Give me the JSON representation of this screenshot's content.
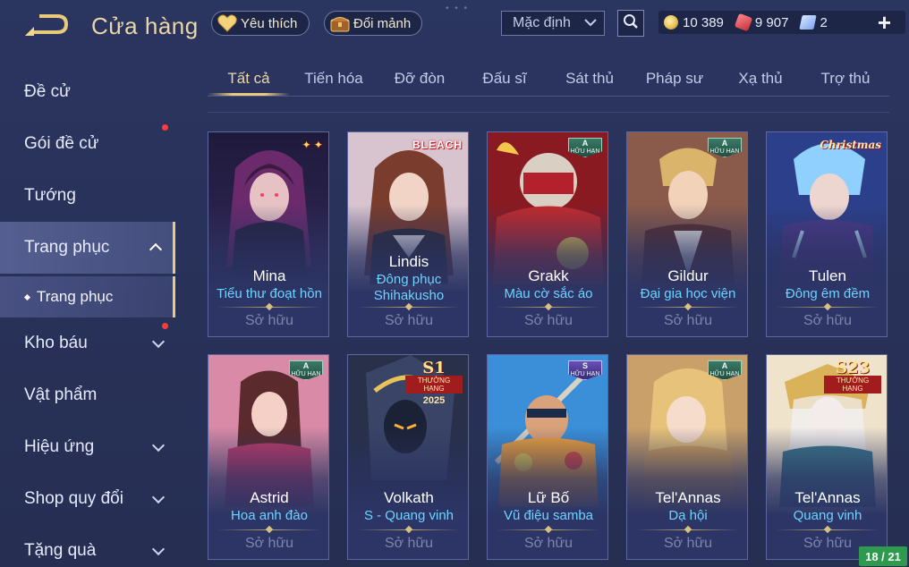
{
  "header": {
    "title": "Cửa hàng",
    "favorites_label": "Yêu thích",
    "shards_label": "Đổi mảnh",
    "sort_selected": "Mặc định",
    "currencies": [
      {
        "name": "gold",
        "icon": "gold-coin-icon",
        "value": "10 389",
        "color": "#e8c15a"
      },
      {
        "name": "gems",
        "icon": "red-gem-icon",
        "value": "9 907",
        "color": "#e0525a"
      },
      {
        "name": "vouchers",
        "icon": "voucher-icon",
        "value": "2",
        "color": "#8fb6ff"
      }
    ]
  },
  "sidebar": {
    "items": [
      {
        "label": "Đề cử"
      },
      {
        "label": "Gói đề cử"
      },
      {
        "label": "Tướng"
      },
      {
        "label": "Trang phục"
      },
      {
        "label": "Kho báu"
      },
      {
        "label": "Vật phẩm"
      },
      {
        "label": "Hiệu ứng"
      },
      {
        "label": "Shop quy đổi"
      },
      {
        "label": "Tặng quà"
      }
    ],
    "sub_item": "Trang phục"
  },
  "tabs": [
    {
      "label": "Tất cả"
    },
    {
      "label": "Tiến hóa"
    },
    {
      "label": "Đỡ đòn"
    },
    {
      "label": "Đấu sĩ"
    },
    {
      "label": "Sát thủ"
    },
    {
      "label": "Pháp sư"
    },
    {
      "label": "Xạ thủ"
    },
    {
      "label": "Trợ thủ"
    }
  ],
  "cards": [
    {
      "hero": "Mina",
      "skin": "Tiểu thư đoạt hồn",
      "status": "Sở hữu"
    },
    {
      "hero": "Lindis",
      "skin": "Đông phục Shihakusho",
      "status": "Sở hữu",
      "badge_text": "BLEACH"
    },
    {
      "hero": "Grakk",
      "skin": "Màu cờ sắc áo",
      "status": "Sở hữu",
      "badge": "A",
      "badge_sub": "HỮU HẠN"
    },
    {
      "hero": "Gildur",
      "skin": "Đại gia học viện",
      "status": "Sở hữu",
      "badge": "A",
      "badge_sub": "HỮU HẠN"
    },
    {
      "hero": "Tulen",
      "skin": "Đông êm đềm",
      "status": "Sở hữu",
      "badge_text": "Christmas"
    },
    {
      "hero": "Astrid",
      "skin": "Hoa anh đào",
      "status": "Sở hữu",
      "badge": "A",
      "badge_sub": "HỮU HẠN"
    },
    {
      "hero": "Volkath",
      "skin": "S - Quang vinh",
      "status": "Sở hữu",
      "rank_badge": "S1",
      "rank_label": "THƯỞNG HẠNG",
      "rank_year": "2025"
    },
    {
      "hero": "Lữ Bố",
      "skin": "Vũ điệu samba",
      "status": "Sở hữu",
      "badge": "S",
      "badge_sub": "HỮU HẠN"
    },
    {
      "hero": "Tel'Annas",
      "skin": "Dạ hội",
      "status": "Sở hữu",
      "badge": "A",
      "badge_sub": "HỮU HẠN"
    },
    {
      "hero": "Tel'Annas",
      "skin": "Quang vinh",
      "status": "Sở hữu",
      "rank_badge": "S23",
      "rank_label": "THƯỞNG HẠNG"
    }
  ],
  "page_counter": "18 / 21",
  "colors": {
    "accent_gold": "#e9c97c",
    "skin_name": "#6fd3ff",
    "background": "#29325a",
    "notify_dot": "#ff3b3b",
    "counter_bg": "#2e9a4e"
  }
}
